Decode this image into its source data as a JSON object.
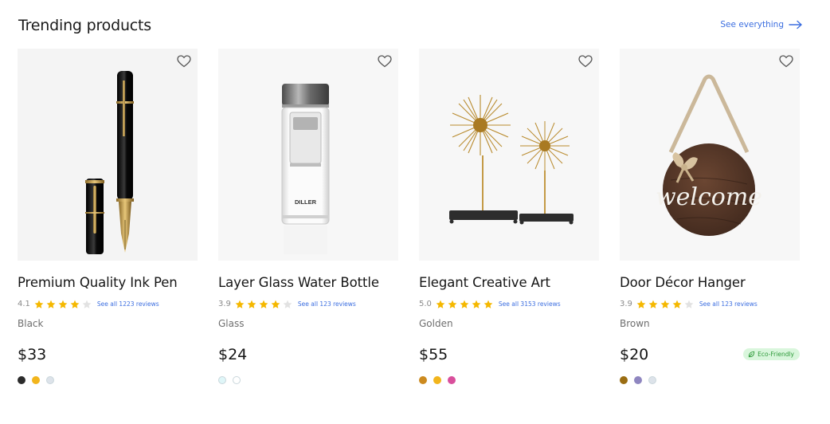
{
  "section": {
    "title": "Trending products",
    "see_all_label": "See everything"
  },
  "colors": {
    "link": "#3d6fe0",
    "star_filled": "#f5b800",
    "star_empty": "#e2e2e2",
    "badge_bg": "#d9f6dc",
    "badge_text": "#2e9a3a"
  },
  "products": [
    {
      "name": "Premium Quality Ink Pen",
      "rating": "4.1",
      "stars": 4,
      "reviews_label": "See all 1223 reviews",
      "variant": "Black",
      "price": "$33",
      "badge": "",
      "image": "fountain-pen",
      "swatches": [
        "#2b2b2b",
        "#f2b51c",
        "#dde3ea"
      ]
    },
    {
      "name": "Layer Glass Water Bottle",
      "rating": "3.9",
      "stars": 4,
      "reviews_label": "See all 123 reviews",
      "variant": "Glass",
      "price": "$24",
      "badge": "",
      "image": "glass-bottle",
      "bottle_label": "DILLER",
      "swatches": [
        "#dff6f8",
        "#ffffff"
      ]
    },
    {
      "name": "Elegant Creative Art",
      "rating": "5.0",
      "stars": 5,
      "reviews_label": "See all 3153 reviews",
      "variant": "Golden",
      "price": "$55",
      "badge": "",
      "image": "golden-sculpture",
      "swatches": [
        "#cc8a1f",
        "#f2b51c",
        "#d94f9c"
      ]
    },
    {
      "name": "Door Décor Hanger",
      "rating": "3.9",
      "stars": 4,
      "reviews_label": "See all 123 reviews",
      "variant": "Brown",
      "price": "$20",
      "badge": "Eco-Friendly",
      "image": "welcome-sign",
      "sign_text": "welcome",
      "swatches": [
        "#9a6d12",
        "#8f86c0",
        "#dde3ea"
      ]
    }
  ]
}
